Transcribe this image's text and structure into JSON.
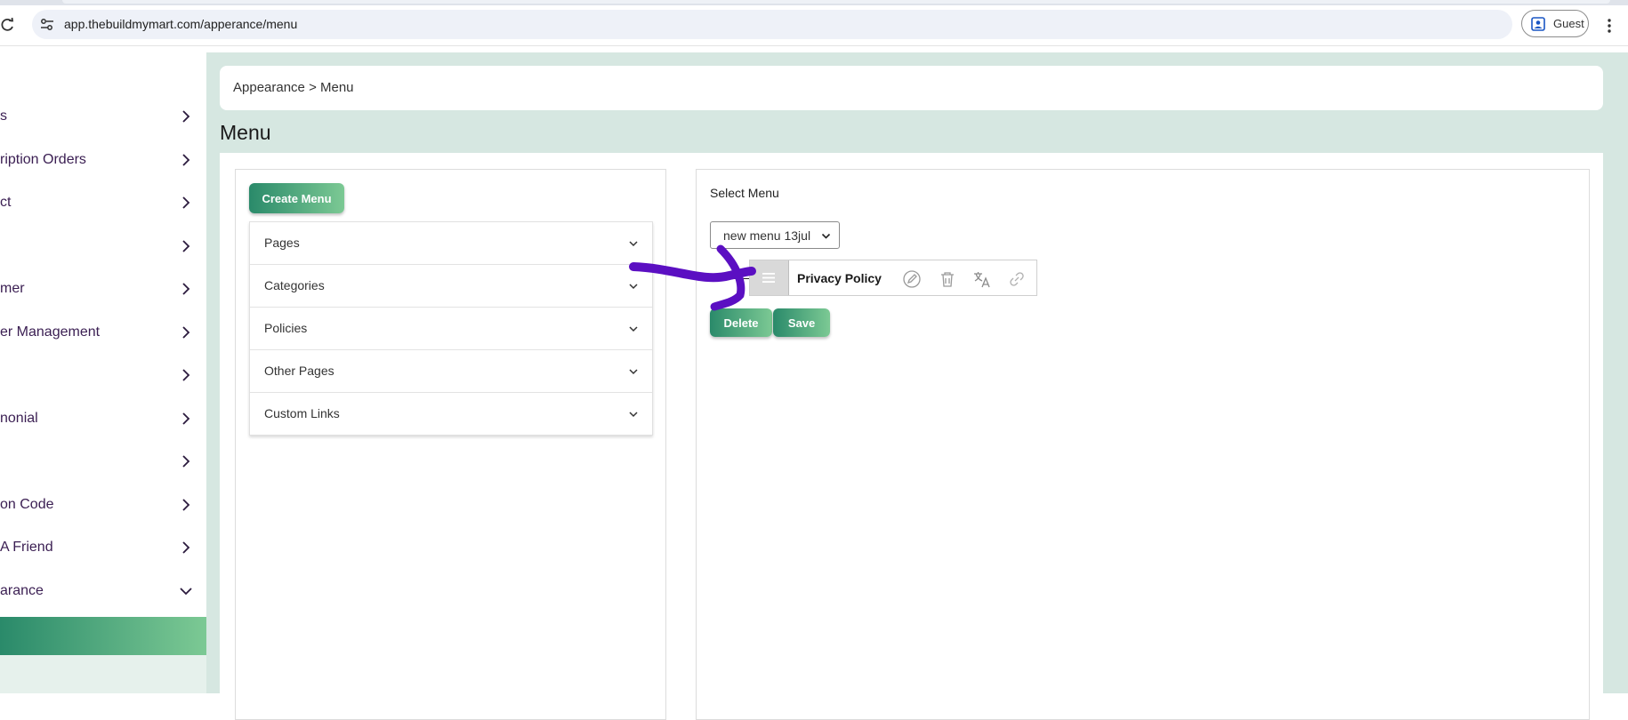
{
  "browser": {
    "url": "app.thebuildmymart.com/apperance/menu",
    "profile_label": "Guest"
  },
  "sidebar": {
    "items": [
      {
        "label": "s"
      },
      {
        "label": "ription Orders"
      },
      {
        "label": "ct"
      },
      {
        "label": ""
      },
      {
        "label": "mer"
      },
      {
        "label": "er Management"
      },
      {
        "label": ""
      },
      {
        "label": "nonial"
      },
      {
        "label": ""
      },
      {
        "label": "on Code"
      },
      {
        "label": "A Friend"
      },
      {
        "label": "arance"
      }
    ]
  },
  "breadcrumb": "Appearance > Menu",
  "page_title": "Menu",
  "left_panel": {
    "create_button": "Create Menu",
    "accordion": [
      {
        "label": "Pages"
      },
      {
        "label": "Categories"
      },
      {
        "label": "Policies"
      },
      {
        "label": "Other Pages"
      },
      {
        "label": "Custom Links"
      }
    ]
  },
  "right_panel": {
    "select_label": "Select Menu",
    "selected_menu": "new menu 13jul",
    "menu_item_title": "Privacy Policy",
    "delete_button": "Delete",
    "save_button": "Save"
  },
  "colors": {
    "accent_gradient_start": "#2a8a6a",
    "accent_gradient_end": "#7cc994",
    "main_background": "#d6e7e1",
    "annotation_arrow": "#5b0fc2",
    "sidebar_text": "#3a1e52"
  },
  "icons": {
    "reload": "reload-icon",
    "site_settings": "tune-icon",
    "profile": "profile-icon",
    "menu": "kebab-icon",
    "row_actions": [
      "edit-icon",
      "trash-icon",
      "translate-icon",
      "link-icon"
    ]
  }
}
